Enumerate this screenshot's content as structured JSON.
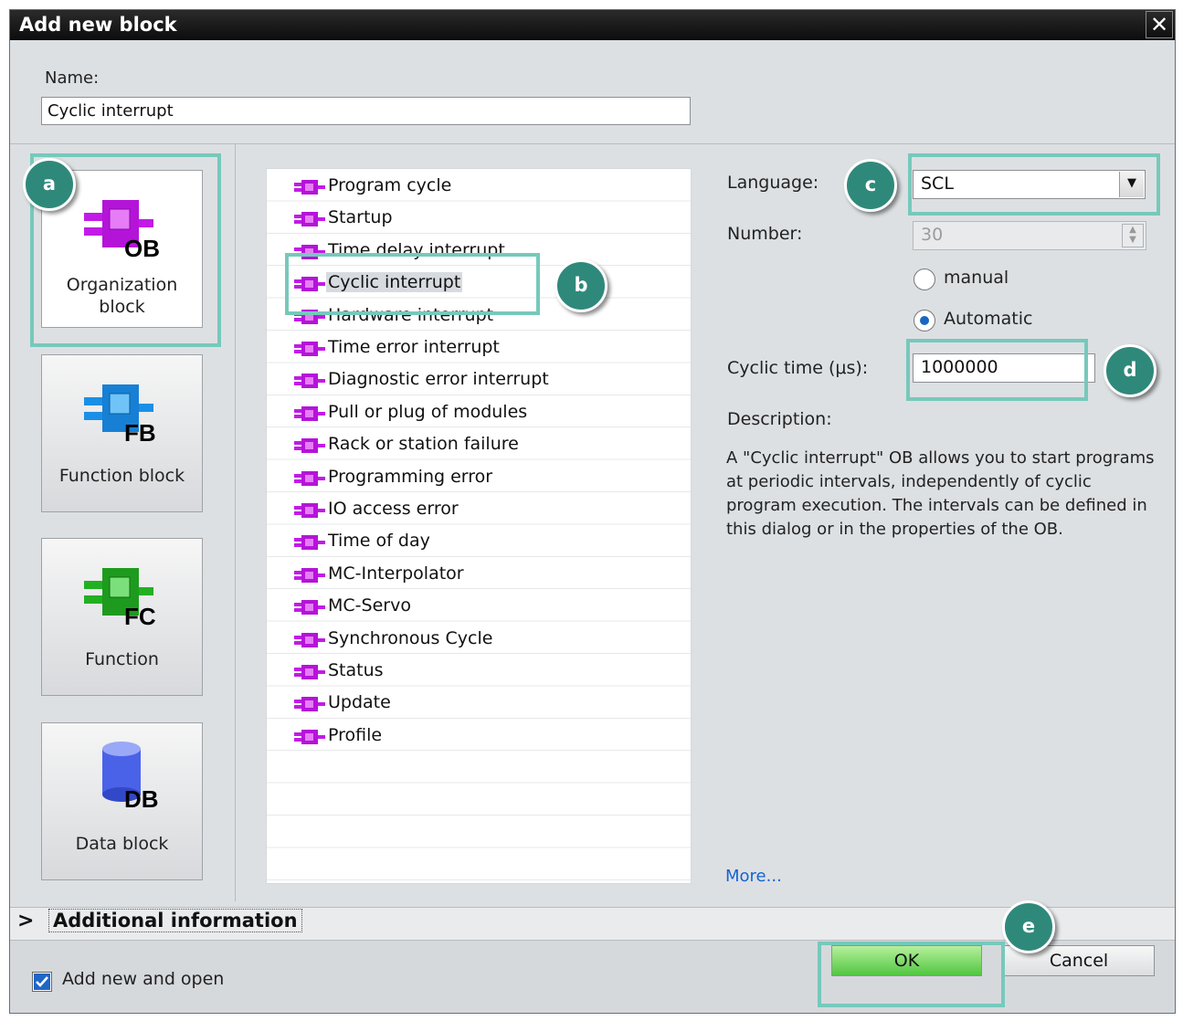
{
  "dialog": {
    "title": "Add new block",
    "close_symbol": "✕",
    "name_label": "Name:",
    "name_value": "Cyclic interrupt"
  },
  "block_types": [
    {
      "badge": "OB",
      "label": "Organization\nblock",
      "color": "#c21be6",
      "icon": "ob-block-icon",
      "selected": true
    },
    {
      "badge": "FB",
      "label": "Function block",
      "color": "#1b8fe6",
      "icon": "fb-block-icon",
      "selected": false
    },
    {
      "badge": "FC",
      "label": "Function",
      "color": "#22b022",
      "icon": "fc-block-icon",
      "selected": false
    },
    {
      "badge": "DB",
      "label": "Data block",
      "color": "#4a62e8",
      "icon": "db-cylinder-icon",
      "selected": false
    }
  ],
  "ob_list": [
    "Program cycle",
    "Startup",
    "Time delay interrupt",
    "Cyclic interrupt",
    "Hardware interrupt",
    "Time error interrupt",
    "Diagnostic error interrupt",
    "Pull or plug of modules",
    "Rack or station failure",
    "Programming error",
    "IO access error",
    "Time of day",
    "MC-Interpolator",
    "MC-Servo",
    "Synchronous Cycle",
    "Status",
    "Update",
    "Profile"
  ],
  "selected_ob": "Cyclic interrupt",
  "properties": {
    "language_label": "Language:",
    "language_value": "SCL",
    "number_label": "Number:",
    "number_value": "30",
    "radio_manual": "manual",
    "radio_automatic": "Automatic",
    "numbering_mode": "Automatic",
    "cyclic_time_label": "Cyclic time (μs):",
    "cyclic_time_value": "1000000",
    "description_label": "Description:",
    "description_text": "A \"Cyclic interrupt\" OB allows you to start programs at periodic intervals, independently of cyclic program execution. The intervals can be defined in this dialog or in the properties of the OB.",
    "more_link": "More..."
  },
  "additional_info": {
    "arrow": ">",
    "label": "Additional  information"
  },
  "footer": {
    "add_new_and_open_label": "Add new and open",
    "add_new_and_open_checked": true,
    "ok_label": "OK",
    "cancel_label": "Cancel"
  },
  "callouts": {
    "a": "a",
    "b": "b",
    "c": "c",
    "d": "d",
    "e": "e",
    "color": "#2f897b",
    "highlight_color": "#76c9bb"
  }
}
